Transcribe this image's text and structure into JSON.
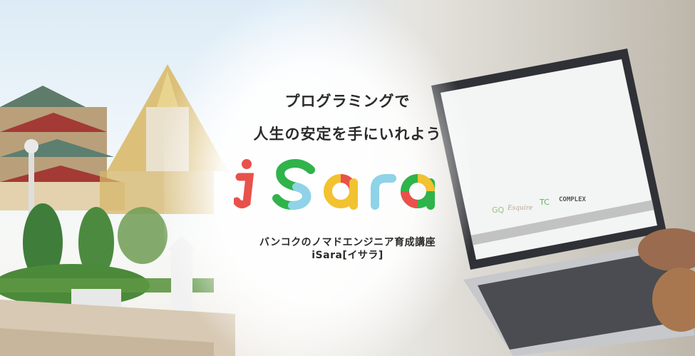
{
  "hero": {
    "tagline_line1": "プログラミングで",
    "tagline_line2": "人生の安定を手にいれよう",
    "logo_text": "iSara",
    "subtitle_line1": "バンコクのノマドエンジニア育成講座",
    "subtitle_line2": "iSara[イサラ]"
  },
  "screen_logos": [
    "GQ",
    "Esquire",
    "TC",
    "COMPLEX"
  ],
  "colors": {
    "text": "#2b2b2b",
    "logo_red": "#e8524a",
    "logo_yellow": "#f2c230",
    "logo_green": "#2fb34a",
    "logo_blue": "#8fd3e8"
  }
}
